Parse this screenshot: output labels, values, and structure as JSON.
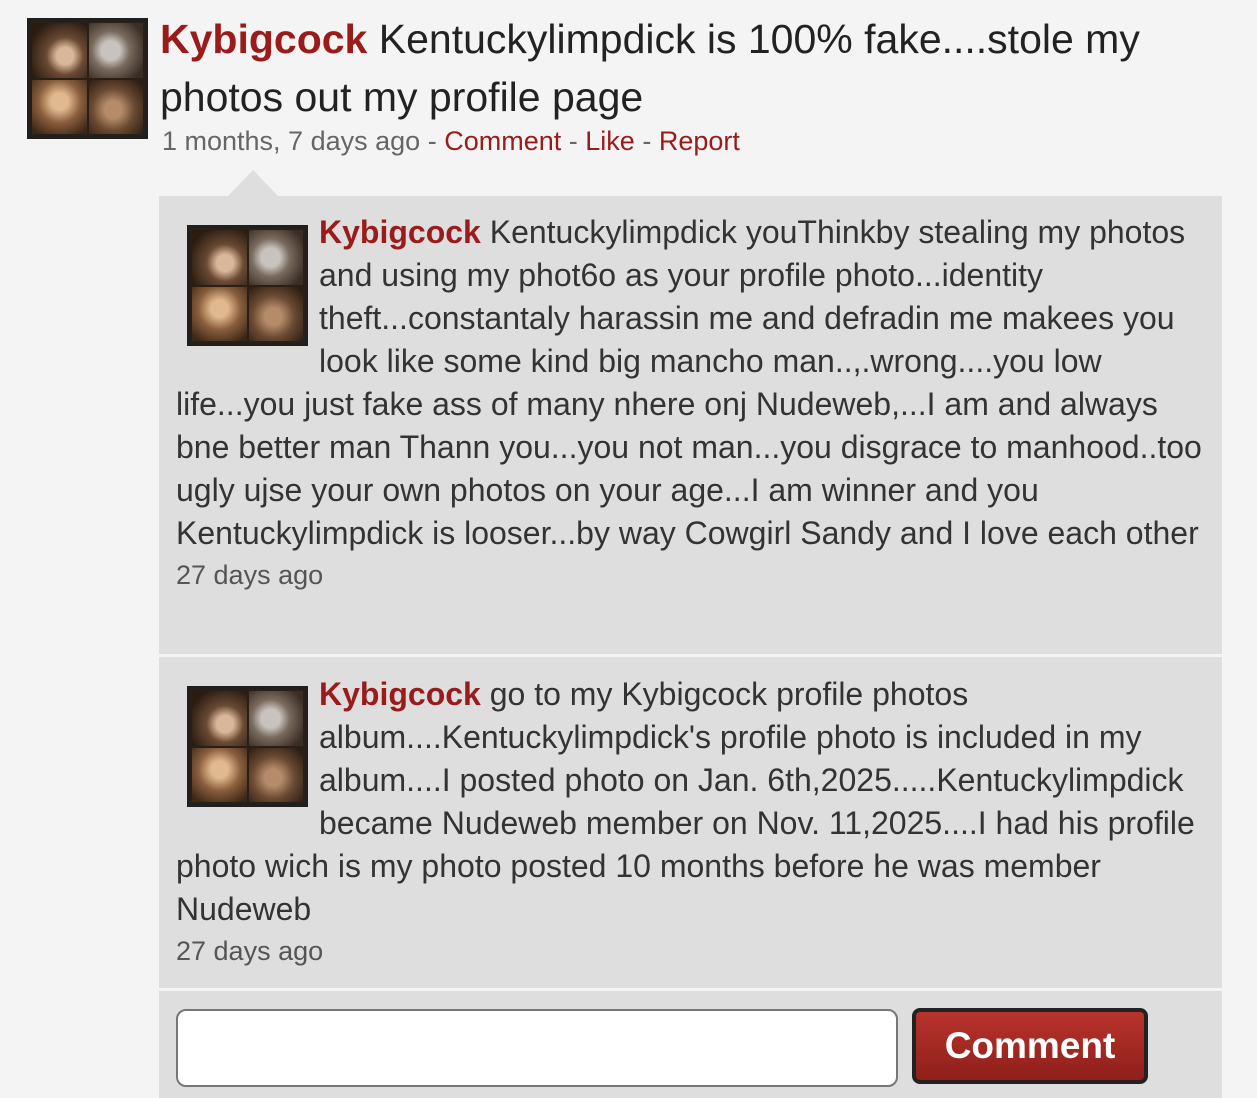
{
  "post": {
    "username": "Kybigcock",
    "text": "Kentuckylimpdick is 100% fake....stole my photos out my profile page",
    "time": "1 months, 7 days ago",
    "separator": "-",
    "actions": {
      "comment": "Comment",
      "like": "Like",
      "report": "Report"
    }
  },
  "comments": [
    {
      "username": "Kybigcock",
      "text": "Kentuckylimpdick youThinkby stealing my photos and using my phot6o as your profile photo...identity theft...constantaly harassin me and defradin me makees you look like some kind big mancho man..,.wrong....you low life...you just fake ass of many nhere onj Nudeweb,...I am and always bne better man Thann you...you not man...you disgrace to manhood..too ugly ujse your own photos on your age...I am winner and you Kentuckylimpdick is looser...by way Cowgirl Sandy and I love each other",
      "time": "27 days ago"
    },
    {
      "username": "Kybigcock",
      "text": "go to my Kybigcock profile photos album....Kentuckylimpdick's profile photo is included in my album....I posted photo on Jan. 6th,2025.....Kentuckylimpdick became Nudeweb member on Nov. 11,2025....I had his profile photo wich is my photo posted 10 months before he was member Nudeweb",
      "time": "27 days ago"
    }
  ],
  "reply": {
    "input_value": "",
    "button_label": "Comment"
  },
  "colors": {
    "accent": "#9b1b1b",
    "panel": "#dedede",
    "background": "#f4f4f4",
    "button": "#a8281f"
  }
}
